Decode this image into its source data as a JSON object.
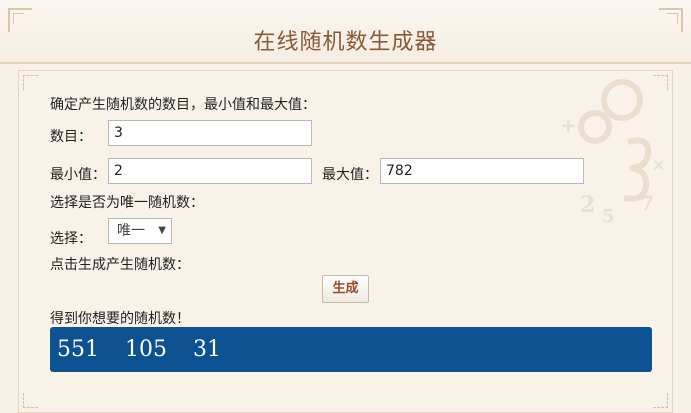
{
  "header": {
    "title": "在线随机数生成器"
  },
  "form": {
    "intro_label": "确定产生随机数的数目，最小值和最大值：",
    "count_label": "数目：",
    "count_value": "3",
    "min_label": "最小值：",
    "min_value": "2",
    "max_label": "最大值：",
    "max_value": "782",
    "unique_prompt": "选择是否为唯一随机数：",
    "choose_label": "选择：",
    "choose_value": "唯一",
    "generate_prompt": "点击生成产生随机数：",
    "generate_button": "生成",
    "result_label": "得到你想要的随机数！",
    "result_value": "551  105  31"
  },
  "colors": {
    "title": "#8a5a35",
    "result_background": "#0c5292",
    "button_text": "#9a4a2a"
  }
}
